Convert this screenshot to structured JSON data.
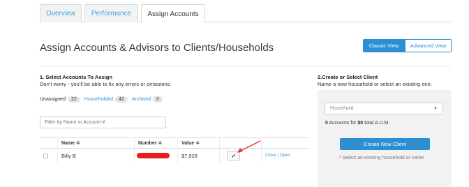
{
  "tabs": [
    "Overview",
    "Performance",
    "Assign Accounts"
  ],
  "page_title": "Assign Accounts & Advisors to Clients/Households",
  "view_toggle": {
    "classic": "Classic View",
    "advanced": "Advanced View"
  },
  "section1": {
    "title": "1. Select Accounts To Assign",
    "subtitle": "Don’t worry - you’ll be able to fix any errors or omissions."
  },
  "filters": {
    "unassigned_label": "Unassigned",
    "unassigned_count": "22",
    "householded_label": "Householded",
    "householded_count": "42",
    "archived_label": "Archived",
    "archived_count": "0"
  },
  "search": {
    "placeholder": "Filter by Name or Account #"
  },
  "table": {
    "headers": [
      "Name ≑",
      "Number ≑",
      "Value ≑"
    ],
    "rows": [
      {
        "name": "Billy B",
        "value": "$7,928",
        "close": "Close",
        "open": "Open"
      }
    ]
  },
  "section2": {
    "title": "2.Create or Select Client",
    "subtitle": "Name a new household or select an existing one."
  },
  "client_panel": {
    "dropdown_value": "Household",
    "aum_prefix": "0",
    "aum_mid": "Accounts for",
    "aum_amount": "$0",
    "aum_suffix": "total A.U.M.",
    "create_button": "Create New Client",
    "hint": "* Select an existing household or name"
  },
  "colors": {
    "accent": "#2d8fd3",
    "redaction": "#e81d1d",
    "arrow": "#e03a2a"
  }
}
